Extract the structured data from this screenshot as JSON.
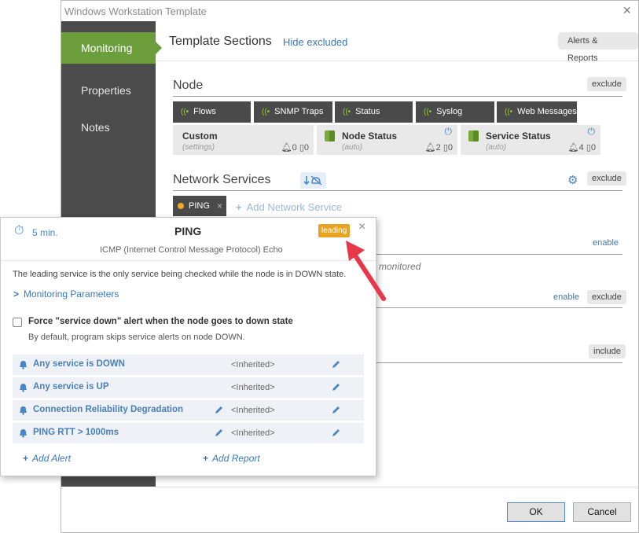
{
  "window": {
    "title": "Windows Workstation Template",
    "close": "×"
  },
  "sidebar": {
    "items": [
      {
        "label": "Monitoring",
        "active": true
      },
      {
        "label": "Properties",
        "active": false
      },
      {
        "label": "Notes",
        "active": false
      }
    ]
  },
  "header": {
    "title": "Template Sections",
    "hide_link": "Hide excluded",
    "alerts_reports": "Alerts & Reports"
  },
  "node": {
    "title": "Node",
    "exclude": "exclude",
    "dark_tiles": [
      "Flows",
      "SNMP Traps",
      "Status",
      "Syslog",
      "Web Messages"
    ],
    "gray_tiles": [
      {
        "name": "Custom",
        "sub": "(settings)",
        "alerts": "0",
        "reports": "0",
        "power": false
      },
      {
        "name": "Node Status",
        "sub": "(auto)",
        "alerts": "2",
        "reports": "0",
        "power": true
      },
      {
        "name": "Service Status",
        "sub": "(auto)",
        "alerts": "4",
        "reports": "0",
        "power": true
      }
    ]
  },
  "network_services": {
    "title": "Network Services",
    "exclude": "exclude",
    "tab_label": "PING",
    "tab_close": "×",
    "add_service": "Add Network Service"
  },
  "background": {
    "enable_1": "enable",
    "monitored_text": "monitored",
    "enable_2": "enable",
    "exclude": "exclude",
    "include": "include"
  },
  "footer": {
    "ok": "OK",
    "cancel": "Cancel"
  },
  "popup": {
    "interval": "5 min.",
    "title": "PING",
    "badge": "leading",
    "close": "×",
    "subtitle": "ICMP (Internet Control Message Protocol) Echo",
    "note": "The leading service is the only service being checked while the node is in DOWN state.",
    "monitoring_params": "Monitoring Parameters",
    "force_checkbox": {
      "label": "Force \"service down\" alert when the node goes to down state",
      "checked": false
    },
    "force_help": "By default, program skips service alerts on node DOWN.",
    "alerts": [
      {
        "name": "Any service is DOWN",
        "value": "<Inherited>",
        "extra_edit": false
      },
      {
        "name": "Any service is UP",
        "value": "<Inherited>",
        "extra_edit": false
      },
      {
        "name": "Connection Reliability Degradation",
        "value": "<Inherited>",
        "extra_edit": true
      },
      {
        "name": "PING RTT > 1000ms",
        "value": "<Inherited>",
        "extra_edit": true
      }
    ],
    "add_alert": "Add Alert",
    "add_report": "Add Report"
  },
  "colors": {
    "sidebar_bg": "#4b4b4b",
    "sidebar_active": "#6b9e3a",
    "link_blue": "#3a78b8",
    "badge_orange": "#e8a420",
    "annotation_arrow": "#e8364a"
  }
}
